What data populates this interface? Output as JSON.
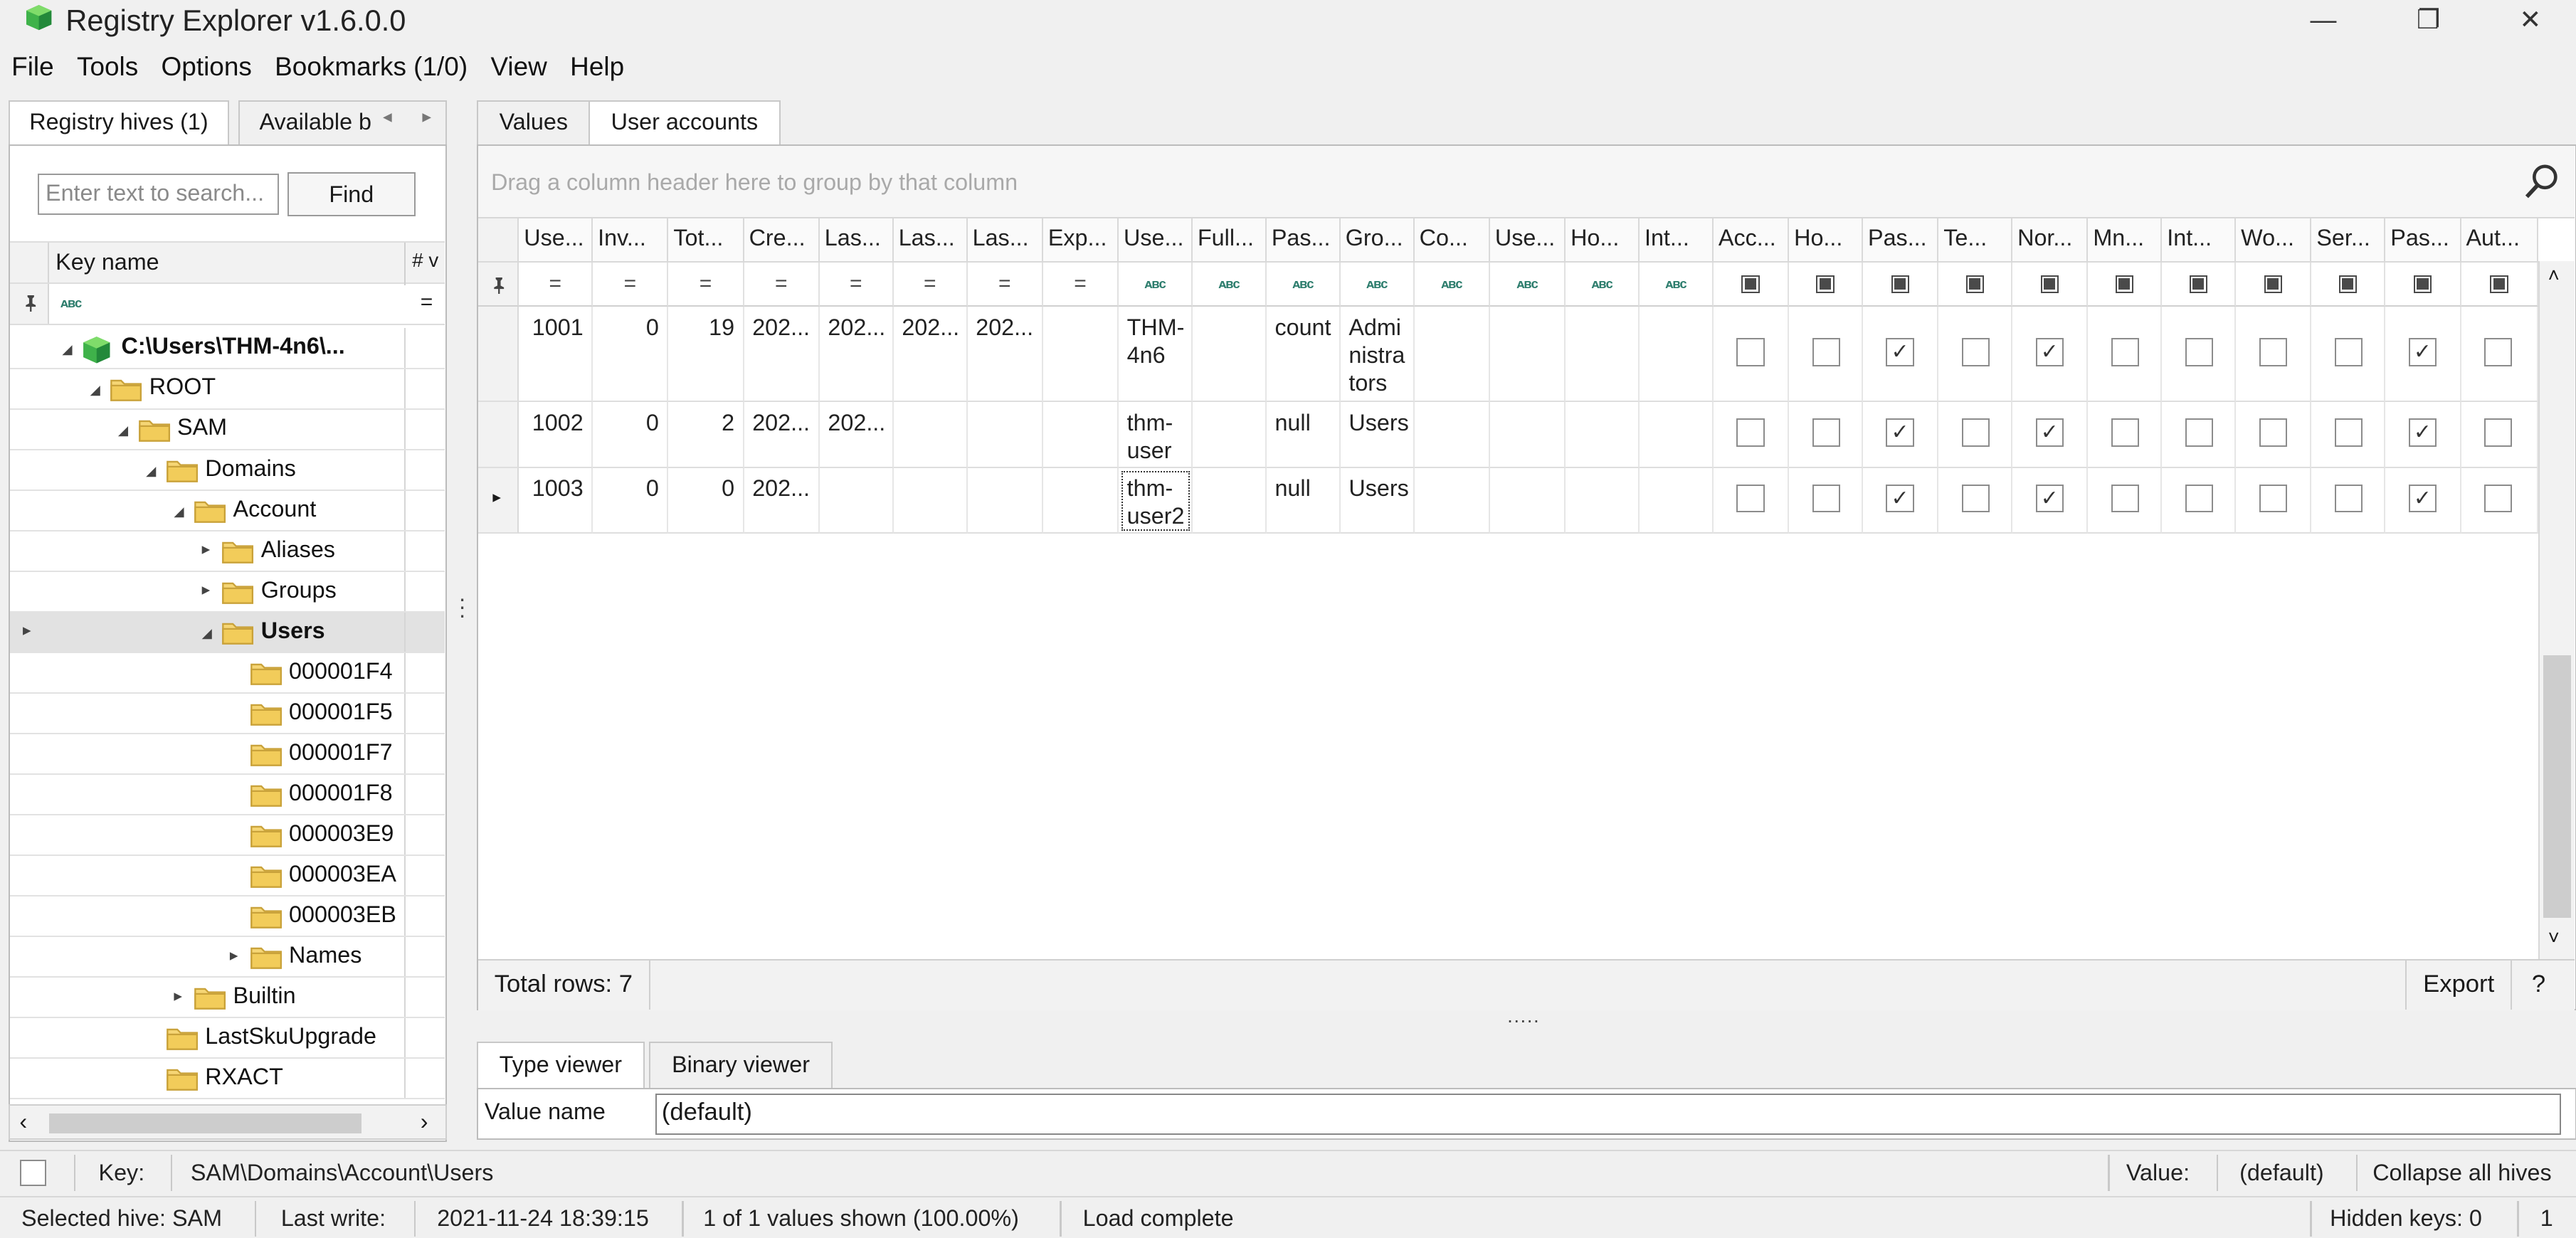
{
  "window": {
    "title": "Registry Explorer v1.6.0.0",
    "minimize": "—",
    "restore": "❐",
    "close": "✕"
  },
  "menu": [
    "File",
    "Tools",
    "Options",
    "Bookmarks (1/0)",
    "View",
    "Help"
  ],
  "left_tabs": {
    "active": "Registry hives (1)",
    "inactive": "Available b",
    "arrow_left": "◂",
    "arrow_right": "▸"
  },
  "search": {
    "placeholder": "Enter text to search...",
    "find_label": "Find"
  },
  "tree_header": {
    "key_name": "Key name",
    "value_col": "# v"
  },
  "tree": [
    {
      "label": "C:\\Users\\THM-4n6\\...",
      "bold": true
    },
    {
      "label": "ROOT"
    },
    {
      "label": "SAM"
    },
    {
      "label": "Domains"
    },
    {
      "label": "Account"
    },
    {
      "label": "Aliases"
    },
    {
      "label": "Groups"
    },
    {
      "label": "Users",
      "bold": true,
      "selected": true
    },
    {
      "label": "000001F4"
    },
    {
      "label": "000001F5"
    },
    {
      "label": "000001F7"
    },
    {
      "label": "000001F8"
    },
    {
      "label": "000003E9"
    },
    {
      "label": "000003EA"
    },
    {
      "label": "000003EB"
    },
    {
      "label": "Names"
    },
    {
      "label": "Builtin"
    },
    {
      "label": "LastSkuUpgrade"
    },
    {
      "label": "RXACT"
    }
  ],
  "right_tabs": {
    "values": "Values",
    "user_accounts": "User accounts"
  },
  "grid": {
    "group_hint": "Drag a column header here to group by that column",
    "columns": [
      "Use...",
      "Inv...",
      "Tot...",
      "Cre...",
      "Las...",
      "Las...",
      "Las...",
      "Exp...",
      "Use...",
      "Full...",
      "Pas...",
      "Gro...",
      "Co...",
      "Use...",
      "Ho...",
      "Int...",
      "Acc...",
      "Ho...",
      "Pas...",
      "Te...",
      "Nor...",
      "Mn...",
      "Int...",
      "Wo...",
      "Ser...",
      "Pas...",
      "Aut..."
    ],
    "rows": [
      {
        "id": "1001",
        "inv": "0",
        "tot": "19",
        "c1": "202...",
        "c2": "202...",
        "c3": "202...",
        "c4": "202...",
        "exp": "",
        "user": "THM-\n4n6",
        "full": "",
        "pass": "count",
        "group": "Admi\nnistra\ntors",
        "checks": [
          false,
          false,
          true,
          false,
          true,
          false,
          false,
          false,
          false,
          true,
          false
        ]
      },
      {
        "id": "1002",
        "inv": "0",
        "tot": "2",
        "c1": "202...",
        "c2": "202...",
        "c3": "",
        "c4": "",
        "exp": "",
        "user": "thm-\nuser",
        "full": "",
        "pass": "null",
        "group": "Users",
        "checks": [
          false,
          false,
          true,
          false,
          true,
          false,
          false,
          false,
          false,
          true,
          false
        ]
      },
      {
        "id": "1003",
        "inv": "0",
        "tot": "0",
        "c1": "202...",
        "c2": "",
        "c3": "",
        "c4": "",
        "exp": "",
        "user": "thm-\nuser2",
        "full": "",
        "pass": "null",
        "group": "Users",
        "checks": [
          false,
          false,
          true,
          false,
          true,
          false,
          false,
          false,
          false,
          true,
          false
        ]
      }
    ],
    "total_rows": "Total rows: 7",
    "export": "Export",
    "help": "?"
  },
  "bottom_tabs": {
    "type_viewer": "Type viewer",
    "binary_viewer": "Binary viewer"
  },
  "value_name": {
    "label": "Value name",
    "value": "(default)"
  },
  "status1": {
    "key_label": "Key:",
    "key_value": "SAM\\Domains\\Account\\Users",
    "value_label": "Value:",
    "value_value": "(default)",
    "collapse": "Collapse all hives"
  },
  "status2": {
    "selected_hive": "Selected hive: SAM",
    "last_write_label": "Last write:",
    "last_write_value": "2021-11-24 18:39:15",
    "values_shown": "1 of 1 values shown (100.00%)",
    "load": "Load complete",
    "hidden_keys": "Hidden keys: 0",
    "num": "1"
  },
  "colors": {
    "accent_green": "#2e9a3e",
    "folder_yellow": "#f2cc5a",
    "selection": "#e2e2e2"
  }
}
